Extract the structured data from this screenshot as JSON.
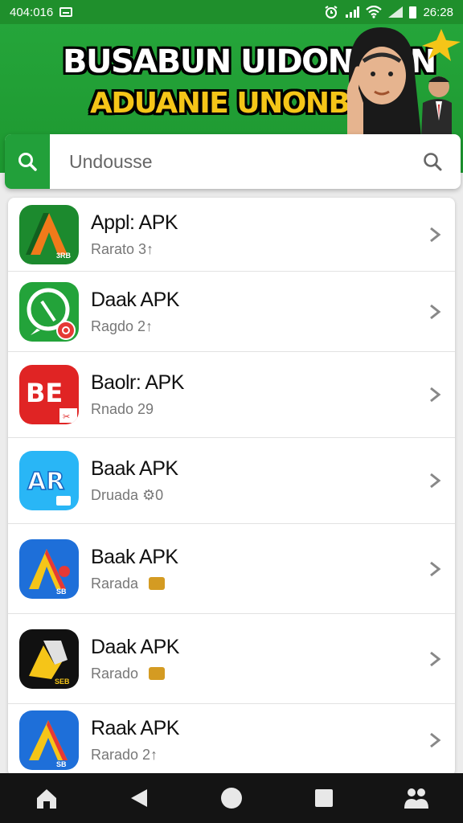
{
  "status_bar": {
    "time_left": "404:016",
    "time_right": "26:28",
    "icons": [
      "sim-icon",
      "alarm-icon",
      "signal-icon",
      "wifi-icon",
      "signal-icon",
      "battery-icon"
    ]
  },
  "banner": {
    "title": "BUSABUN UIDONASIN",
    "subtitle": "ADUANIE UNONBIO!"
  },
  "search": {
    "placeholder": "Undousse",
    "left_icon": "search-icon",
    "right_icon": "search-icon"
  },
  "apps": [
    {
      "name": "Appl: APK",
      "meta": "Rarato  3↑",
      "icon": "app-a-green-icon",
      "colors": [
        "#1c8a2e",
        "#f07a1a"
      ]
    },
    {
      "name": "Daak APK",
      "meta": "Ragdo  2↑",
      "icon": "app-whatsapp-like-icon",
      "colors": [
        "#23a33a",
        "#e53935"
      ]
    },
    {
      "name": "Baolr: APK",
      "meta": "Rnado  29",
      "icon": "app-be-red-icon",
      "colors": [
        "#e02424",
        "#ffffff"
      ]
    },
    {
      "name": "Baak APK",
      "meta": "Druada  ⚙0",
      "icon": "app-ar-blue-icon",
      "colors": [
        "#29b6f6",
        "#1565c0"
      ]
    },
    {
      "name": "Baak APK",
      "meta": "Rarada",
      "icon": "app-a-blue-icon",
      "colors": [
        "#1e6fd9",
        "#f5c518"
      ]
    },
    {
      "name": "Daak APK",
      "meta": "Rarado",
      "icon": "app-a-black-icon",
      "colors": [
        "#111111",
        "#f5c518"
      ]
    },
    {
      "name": "Raak APK",
      "meta": "Rarado  2↑",
      "icon": "app-a-blue-2-icon",
      "colors": [
        "#1e6fd9",
        "#f5c518"
      ]
    }
  ],
  "nav": {
    "buttons": [
      "home-icon",
      "back-icon",
      "circle-home-icon",
      "recents-icon",
      "people-icon"
    ]
  },
  "colors": {
    "brand_green": "#22a03a",
    "status_green": "#1f8f2c",
    "nav_black": "#141414"
  }
}
